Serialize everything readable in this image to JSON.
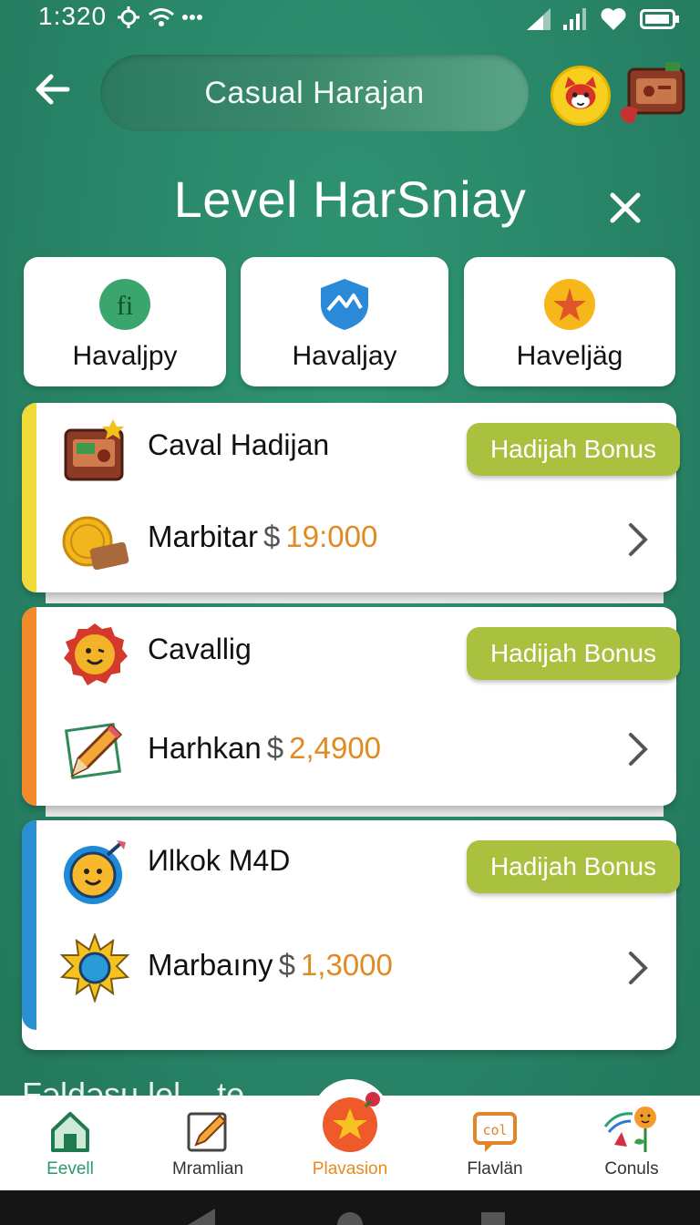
{
  "status_bar": {
    "time": "1:320",
    "icons": [
      "settings-icon",
      "wifi-icon",
      "more-dots-icon",
      "signal-icon",
      "signal-icon",
      "heart-icon",
      "battery-icon"
    ]
  },
  "header": {
    "search_text": "Casual Harajan",
    "title": "Level HarSniay"
  },
  "categories": [
    {
      "label": "Havaljpy",
      "icon_text": "fi",
      "icon": "fi-badge-icon"
    },
    {
      "label": "Havaljay",
      "icon": "shield-icon"
    },
    {
      "label": "Haveljäg",
      "icon": "star-icon"
    }
  ],
  "offers": [
    {
      "title": "Caval Hadijan",
      "badge": "Hadijah Bonus",
      "sub_label": "Marbitar",
      "currency": "$",
      "amount": "19:000",
      "stripe_color": "#f1d93a",
      "title_icon": "radio-icon",
      "sub_icon": "coin-wallet-icon"
    },
    {
      "title": "Cavallig",
      "badge": "Hadijah Bonus",
      "sub_label": "Harhkan",
      "currency": "$",
      "amount": "2,4900",
      "stripe_color": "#f08a2a",
      "title_icon": "smiley-badge-icon",
      "sub_icon": "pencil-icon"
    },
    {
      "title": "Иlkok M4D",
      "badge": "Hadijah Bonus",
      "sub_label": "Marbaıny",
      "currency": "$",
      "amount": "1,3000",
      "stripe_color": "#2a8fd0",
      "title_icon": "smiley-dart-icon",
      "sub_icon": "sun-icon"
    }
  ],
  "partial_text": "Fəldəsu lel ...te",
  "bottom_nav": [
    {
      "label": "Eevell",
      "icon": "home-icon",
      "color": "#2a9a6a"
    },
    {
      "label": "Mramlian",
      "icon": "pencil-icon",
      "color": "#333333"
    },
    {
      "label": "Plavasion",
      "icon": "star-icon",
      "color": "#e88a1e"
    },
    {
      "label": "Flavlän",
      "icon": "chat-icon",
      "color": "#333333"
    },
    {
      "label": "Conuls",
      "icon": "smiley-flower-icon",
      "color": "#333333"
    }
  ]
}
